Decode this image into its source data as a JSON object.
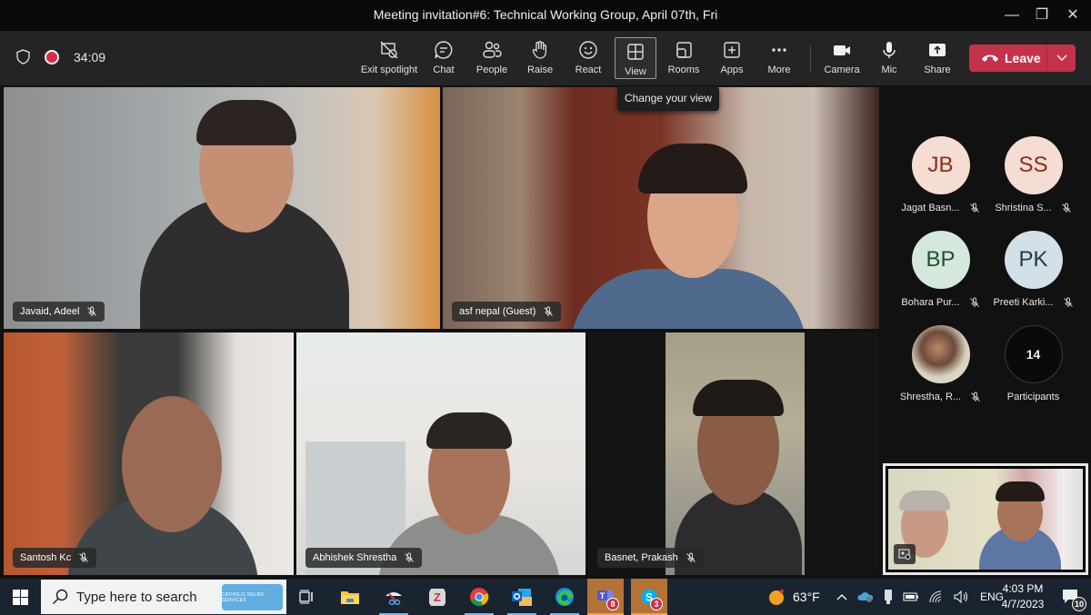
{
  "window": {
    "title": "Meeting invitation#6: Technical Working Group, April 07th, Fri",
    "controls": {
      "minimize": "—",
      "restore": "❐",
      "close": "✕"
    }
  },
  "meeting": {
    "timer": "34:09",
    "recording": true,
    "toolbar": [
      {
        "id": "exit-spotlight",
        "label": "Exit spotlight",
        "icon": "exit-spotlight-icon"
      },
      {
        "id": "chat",
        "label": "Chat",
        "icon": "chat-icon"
      },
      {
        "id": "people",
        "label": "People",
        "icon": "people-icon"
      },
      {
        "id": "raise",
        "label": "Raise",
        "icon": "raise-hand-icon"
      },
      {
        "id": "react",
        "label": "React",
        "icon": "smiley-icon"
      },
      {
        "id": "view",
        "label": "View",
        "icon": "grid-view-icon",
        "active": true
      },
      {
        "id": "rooms",
        "label": "Rooms",
        "icon": "rooms-icon"
      },
      {
        "id": "apps",
        "label": "Apps",
        "icon": "plus-square-icon"
      },
      {
        "id": "more",
        "label": "More",
        "icon": "more-dots-icon"
      },
      {
        "id": "camera",
        "label": "Camera",
        "icon": "camera-icon"
      },
      {
        "id": "mic",
        "label": "Mic",
        "icon": "microphone-icon"
      },
      {
        "id": "share",
        "label": "Share",
        "icon": "share-icon"
      }
    ],
    "leave_label": "Leave",
    "tooltip": "Change your view",
    "accent_leave": "#c4314b"
  },
  "videos": [
    {
      "name": "Javaid, Adeel",
      "muted": true
    },
    {
      "name": "asf nepal (Guest)",
      "muted": true
    },
    {
      "name": "Santosh Kc",
      "muted": true
    },
    {
      "name": "Abhishek Shrestha",
      "muted": true
    },
    {
      "name": "Basnet, Prakash",
      "muted": true
    }
  ],
  "roster": [
    {
      "initials": "JB",
      "name": "Jagat Basn...",
      "muted": true,
      "bg": "#f5ddd4",
      "fg": "#8b2e1a"
    },
    {
      "initials": "SS",
      "name": "Shristina S...",
      "muted": true,
      "bg": "#f5ddd4",
      "fg": "#8b2e1a"
    },
    {
      "initials": "BP",
      "name": "Bohara Pur...",
      "muted": true,
      "bg": "#d5e8dc",
      "fg": "#1f4f33"
    },
    {
      "initials": "PK",
      "name": "Preeti Karki...",
      "muted": true,
      "bg": "#d3e0e8",
      "fg": "#1c3a4d"
    },
    {
      "initials": "",
      "name": "Shrestha, R...",
      "muted": true,
      "photo": true
    },
    {
      "initials": "14",
      "name": "Participants",
      "muted": false,
      "overflow": true
    }
  ],
  "taskbar": {
    "search_placeholder": "Type here to search",
    "search_banner": "CATHOLIC RELIEF SERVICES",
    "apps": [
      {
        "name": "task-view",
        "running": false
      },
      {
        "name": "file-explorer",
        "running": false
      },
      {
        "name": "snipping-tool",
        "running": true
      },
      {
        "name": "zotero",
        "running": false
      },
      {
        "name": "chrome",
        "running": true
      },
      {
        "name": "outlook",
        "running": true
      },
      {
        "name": "edge",
        "running": true
      },
      {
        "name": "teams",
        "running": true,
        "flash": true,
        "badge": "8"
      },
      {
        "name": "skype",
        "running": true,
        "flash": true,
        "badge": "3"
      }
    ],
    "weather": "63°F",
    "language": "ENG",
    "time": "4:03 PM",
    "date": "4/7/2023",
    "notifications": "10"
  }
}
